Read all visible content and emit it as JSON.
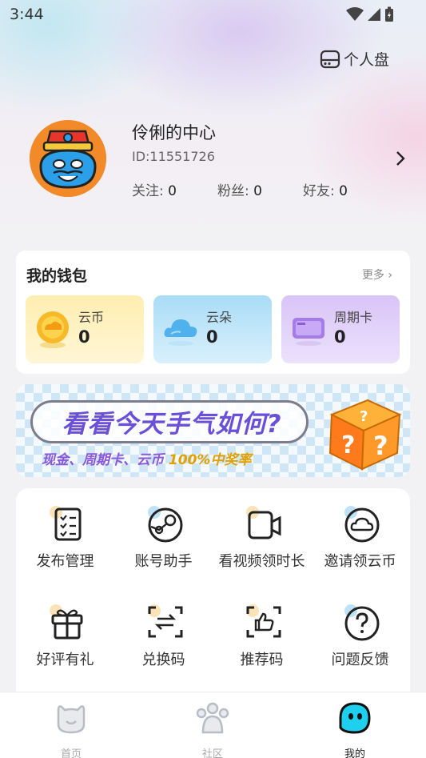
{
  "status_bar": {
    "time": "3:44"
  },
  "header": {
    "drive_label": "个人盘"
  },
  "profile": {
    "name": "伶俐的中心",
    "id_text": "ID:11551726",
    "stats": [
      {
        "label": "关注:",
        "value": "0"
      },
      {
        "label": "粉丝:",
        "value": "0"
      },
      {
        "label": "好友:",
        "value": "0"
      }
    ]
  },
  "wallet": {
    "title": "我的钱包",
    "more": "更多",
    "items": [
      {
        "label": "云币",
        "value": "0",
        "icon": "coin-icon"
      },
      {
        "label": "云朵",
        "value": "0",
        "icon": "cloud-icon"
      },
      {
        "label": "周期卡",
        "value": "0",
        "icon": "card-icon"
      }
    ]
  },
  "banner": {
    "headline": "看看今天手气如何?",
    "sub_prefix": "现金、周期卡、云币",
    "sub_highlight": "100%中奖率"
  },
  "grid": {
    "items": [
      {
        "label": "发布管理",
        "icon": "checklist-icon"
      },
      {
        "label": "账号助手",
        "icon": "steam-icon"
      },
      {
        "label": "看视频领时长",
        "icon": "video-icon"
      },
      {
        "label": "邀请领云币",
        "icon": "cloud-circle-icon"
      },
      {
        "label": "好评有礼",
        "icon": "gift-icon"
      },
      {
        "label": "兑换码",
        "icon": "exchange-icon"
      },
      {
        "label": "推荐码",
        "icon": "thumbs-up-icon"
      },
      {
        "label": "问题反馈",
        "icon": "question-icon"
      }
    ]
  },
  "tabbar": {
    "tabs": [
      {
        "label": "首页",
        "icon": "home-icon",
        "active": false
      },
      {
        "label": "社区",
        "icon": "community-icon",
        "active": false
      },
      {
        "label": "我的",
        "icon": "mine-icon",
        "active": true
      }
    ]
  },
  "colors": {
    "accent": "#6a4fd8",
    "coin_card": "#ffeeb0",
    "cloud_card": "#a9dcf7",
    "period_card": "#d9c4f7",
    "avatar_bg": "#f28a2a"
  }
}
